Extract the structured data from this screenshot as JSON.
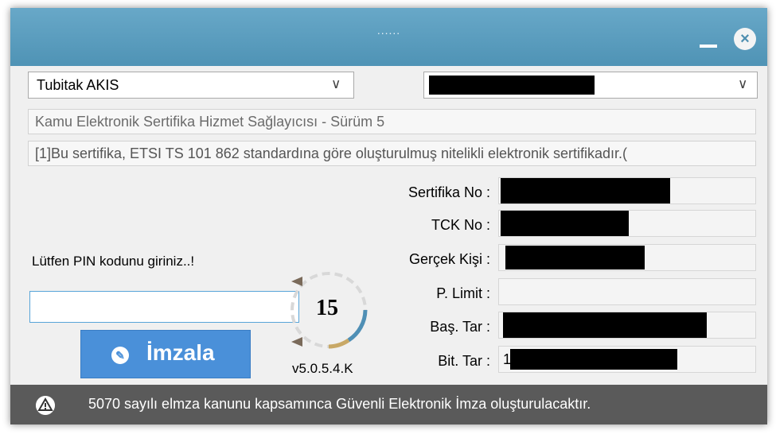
{
  "window": {
    "title": "......",
    "minimize_label": "_",
    "close_label": "×"
  },
  "provider_dropdown": {
    "value": "Tubitak AKIS"
  },
  "certificate_dropdown": {
    "value": ""
  },
  "issuer_text": "Kamu Elektronik Sertifika Hizmet Sağlayıcısı - Sürüm 5",
  "policy_text": "[1]Bu sertifika, ETSI TS 101 862 standardına göre oluşturulmuş nitelikli elektronik sertifikadır.(",
  "fields": [
    {
      "label": "Sertifika No :",
      "value": ""
    },
    {
      "label": "TCK No :",
      "value": ""
    },
    {
      "label": "Gerçek Kişi :",
      "value": ""
    },
    {
      "label": "P. Limit :",
      "value": ""
    },
    {
      "label": "Baş. Tar :",
      "value": ""
    },
    {
      "label": "Bit. Tar :",
      "value": "1"
    }
  ],
  "pin": {
    "prompt": "Lütfen PIN kodunu giriniz..!",
    "value": ""
  },
  "sign_button": {
    "label": "İmzala"
  },
  "countdown": {
    "value": "15"
  },
  "version": "v5.0.5.4.K",
  "status": {
    "message": "5070 sayılı elmza kanunu kapsamınca Güvenli Elektronik İmza oluşturulacaktır."
  },
  "colors": {
    "titlebar": "#4f93b5",
    "sign_button": "#4a90d9",
    "statusbar": "#5a5a5a"
  }
}
